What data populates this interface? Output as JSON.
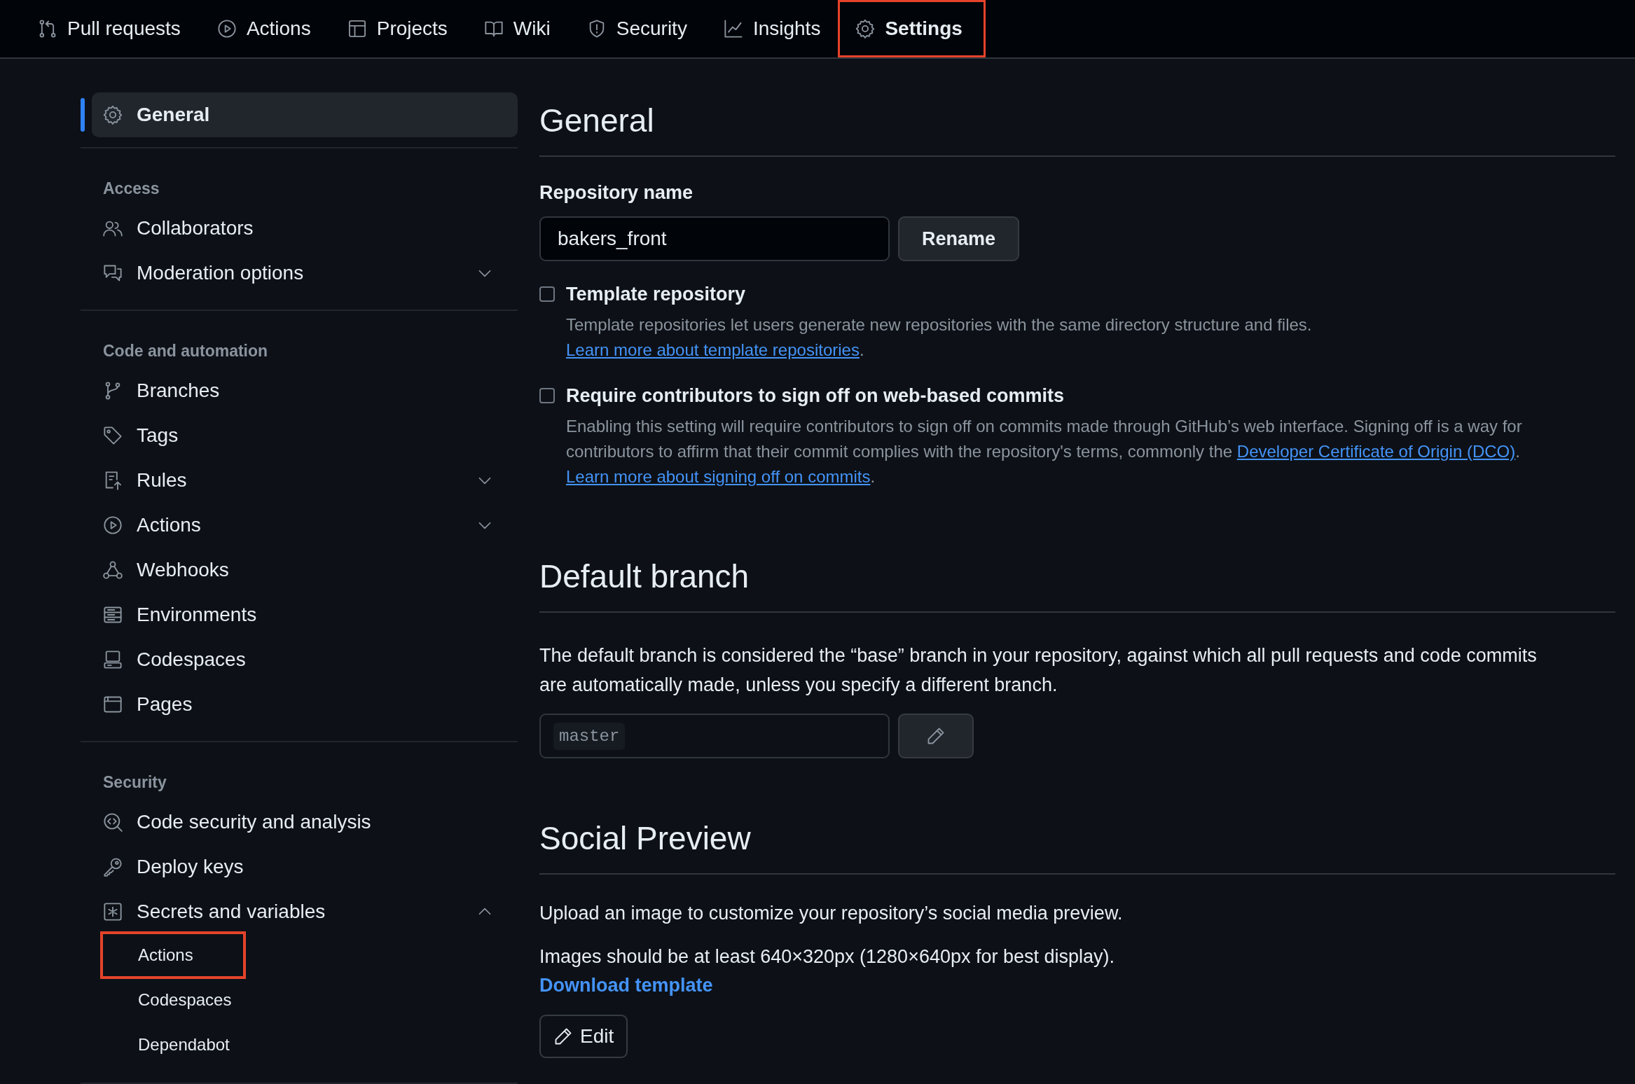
{
  "nav_tabs": [
    {
      "label": "Pull requests",
      "kind": "pull",
      "selected": false,
      "highlighted": false
    },
    {
      "label": "Actions",
      "kind": "play",
      "selected": false,
      "highlighted": false
    },
    {
      "label": "Projects",
      "kind": "table",
      "selected": false,
      "highlighted": false
    },
    {
      "label": "Wiki",
      "kind": "book",
      "selected": false,
      "highlighted": false
    },
    {
      "label": "Security",
      "kind": "shield",
      "selected": false,
      "highlighted": false
    },
    {
      "label": "Insights",
      "kind": "graph",
      "selected": false,
      "highlighted": false
    },
    {
      "label": "Settings",
      "kind": "gear",
      "selected": true,
      "highlighted": true
    }
  ],
  "sidebar": {
    "top_item": {
      "label": "General",
      "kind": "gear",
      "selected": true
    },
    "sections": [
      {
        "heading": "Access",
        "items": [
          {
            "label": "Collaborators",
            "kind": "people",
            "selected": false
          },
          {
            "label": "Moderation options",
            "kind": "comments",
            "selected": false,
            "expanded": false
          }
        ]
      },
      {
        "heading": "Code and automation",
        "items": [
          {
            "label": "Branches",
            "kind": "branch",
            "selected": false
          },
          {
            "label": "Tags",
            "kind": "tag",
            "selected": false
          },
          {
            "label": "Rules",
            "kind": "rules",
            "selected": false,
            "expanded": false
          },
          {
            "label": "Actions",
            "kind": "play",
            "selected": false,
            "expanded": false
          },
          {
            "label": "Webhooks",
            "kind": "webhook",
            "selected": false
          },
          {
            "label": "Environments",
            "kind": "server",
            "selected": false
          },
          {
            "label": "Codespaces",
            "kind": "codespaces",
            "selected": false
          },
          {
            "label": "Pages",
            "kind": "browser",
            "selected": false
          }
        ]
      },
      {
        "heading": "Security",
        "items": [
          {
            "label": "Code security and analysis",
            "kind": "codescan",
            "selected": false
          },
          {
            "label": "Deploy keys",
            "kind": "key",
            "selected": false
          },
          {
            "label": "Secrets and variables",
            "kind": "asterisk",
            "selected": false,
            "expanded": true,
            "children": [
              {
                "label": "Actions",
                "selected": false,
                "highlighted": true
              },
              {
                "label": "Codespaces",
                "selected": false,
                "highlighted": false
              },
              {
                "label": "Dependabot",
                "selected": false,
                "highlighted": false
              }
            ]
          }
        ]
      }
    ]
  },
  "main": {
    "general": {
      "title": "General",
      "repo_name_label": "Repository name",
      "repo_name_value": "bakers_front",
      "rename_button": "Rename",
      "options": [
        {
          "label": "Template repository",
          "checked": false,
          "description": [
            {
              "text": "Template repositories let users generate new repositories with the same directory structure and files. "
            },
            {
              "link": "Learn more about template repositories"
            },
            {
              "text": "."
            }
          ]
        },
        {
          "label": "Require contributors to sign off on web-based commits",
          "checked": false,
          "description": [
            {
              "text": "Enabling this setting will require contributors to sign off on commits made through GitHub’s web interface. Signing off is a way for contributors to affirm that their commit complies with the repository's terms, commonly the "
            },
            {
              "link": "Developer Certificate of Origin (DCO)"
            },
            {
              "text": ". "
            },
            {
              "link": "Learn more about signing off on commits"
            },
            {
              "text": "."
            }
          ]
        }
      ]
    },
    "default_branch": {
      "title": "Default branch",
      "description": "The default branch is considered the “base” branch in your repository, against which all pull requests and code commits are automatically made, unless you specify a different branch.",
      "branch": "master"
    },
    "social_preview": {
      "title": "Social Preview",
      "description": "Upload an image to customize your repository’s social media preview.",
      "size_note": "Images should be at least 640×320px (1280×640px for best display).",
      "download_link": "Download template",
      "edit_button": "Edit"
    }
  }
}
